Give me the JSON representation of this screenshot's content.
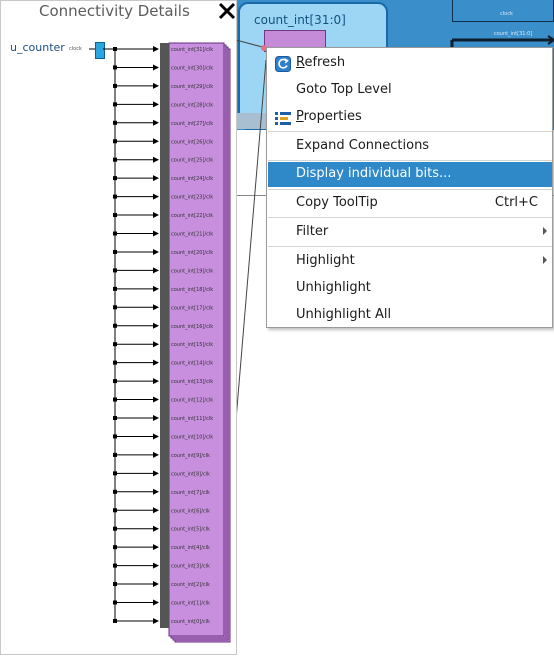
{
  "background": {
    "node_title": "count_int[31:0]",
    "tiny_label_1": "clock",
    "tiny_label_2": "count_int[31:0]"
  },
  "connectivity": {
    "title": "Connectivity Details",
    "source_label": "u_counter",
    "source_pin": "clock",
    "pins": [
      "count_int[31]/clk",
      "count_int[30]/clk",
      "count_int[29]/clk",
      "count_int[28]/clk",
      "count_int[27]/clk",
      "count_int[26]/clk",
      "count_int[25]/clk",
      "count_int[24]/clk",
      "count_int[23]/clk",
      "count_int[22]/clk",
      "count_int[21]/clk",
      "count_int[20]/clk",
      "count_int[19]/clk",
      "count_int[18]/clk",
      "count_int[17]/clk",
      "count_int[16]/clk",
      "count_int[15]/clk",
      "count_int[14]/clk",
      "count_int[13]/clk",
      "count_int[12]/clk",
      "count_int[11]/clk",
      "count_int[10]/clk",
      "count_int[9]/clk",
      "count_int[8]/clk",
      "count_int[7]/clk",
      "count_int[6]/clk",
      "count_int[5]/clk",
      "count_int[4]/clk",
      "count_int[3]/clk",
      "count_int[2]/clk",
      "count_int[1]/clk",
      "count_int[0]/clk"
    ],
    "colors": {
      "block_fill": "#c78fdd",
      "block_border": "#6a2f80",
      "bus_bar": "#555555",
      "port": "#2aa5e0"
    }
  },
  "menu": {
    "items": [
      {
        "label_pre": "",
        "label_ul": "R",
        "label_post": "efresh",
        "icon": "refresh-icon"
      },
      {
        "label": "Goto Top Level"
      },
      {
        "label_pre": "",
        "label_ul": "P",
        "label_post": "roperties",
        "icon": "properties-icon"
      },
      {
        "label": "Expand Connections"
      },
      {
        "label": "Display individual bits...",
        "highlighted": true
      },
      {
        "label": "Copy ToolTip",
        "shortcut": "Ctrl+C"
      },
      {
        "label": "Filter",
        "submenu": true
      },
      {
        "label": "Highlight",
        "submenu": true
      },
      {
        "label": "Unhighlight"
      },
      {
        "label": "Unhighlight All"
      }
    ],
    "highlight_color": "#2f88c8"
  }
}
